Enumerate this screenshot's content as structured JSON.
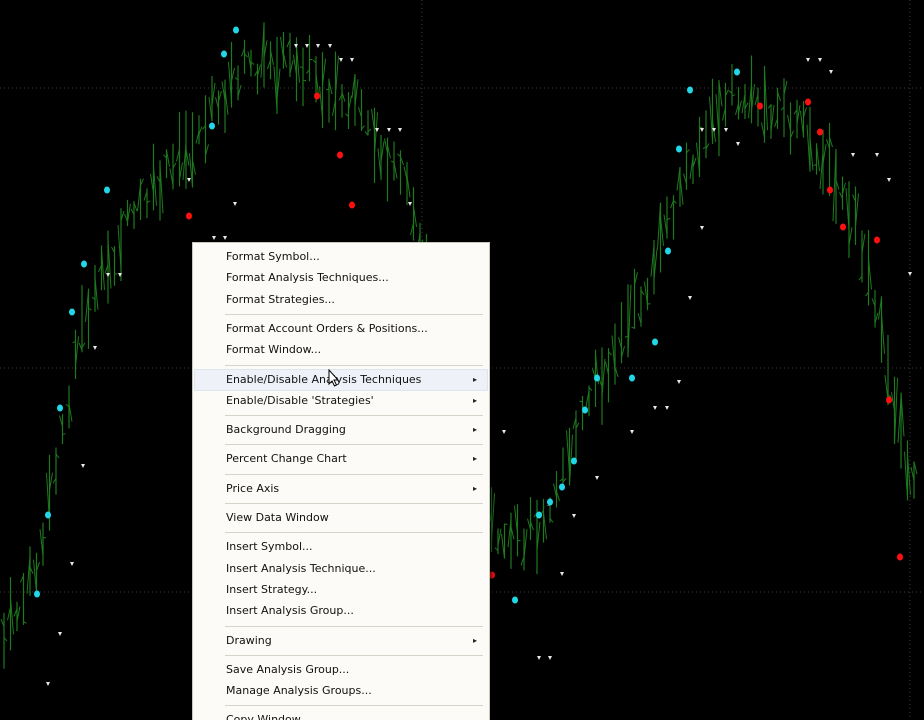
{
  "colors": {
    "background": "#000000",
    "bar": "#1f7a1f",
    "marker_cyan": "#22d8e8",
    "marker_red": "#ff1010",
    "marker_white": "#e8e8e8",
    "menu_bg": "#fcfbf7"
  },
  "context_menu": {
    "items": [
      {
        "label": "Format Symbol...",
        "submenu": false
      },
      {
        "label": "Format Analysis Techniques...",
        "submenu": false
      },
      {
        "label": "Format Strategies...",
        "submenu": false,
        "separator_after": true
      },
      {
        "label": "Format Account Orders & Positions...",
        "submenu": false
      },
      {
        "label": "Format Window...",
        "submenu": false,
        "separator_after": true
      },
      {
        "label": "Enable/Disable Analysis Techniques",
        "submenu": true,
        "highlighted": true
      },
      {
        "label": "Enable/Disable 'Strategies'",
        "submenu": true,
        "separator_after": true
      },
      {
        "label": "Background Dragging",
        "submenu": true,
        "separator_after": true
      },
      {
        "label": "Percent Change Chart",
        "submenu": true,
        "separator_after": true
      },
      {
        "label": "Price Axis",
        "submenu": true,
        "separator_after": true
      },
      {
        "label": "View Data Window",
        "submenu": false,
        "separator_after": true
      },
      {
        "label": "Insert Symbol...",
        "submenu": false
      },
      {
        "label": "Insert Analysis Technique...",
        "submenu": false
      },
      {
        "label": "Insert Strategy...",
        "submenu": false
      },
      {
        "label": "Insert Analysis Group...",
        "submenu": false,
        "separator_after": true
      },
      {
        "label": "Drawing",
        "submenu": true,
        "separator_after": true
      },
      {
        "label": "Save Analysis Group...",
        "submenu": false
      },
      {
        "label": "Manage Analysis Groups...",
        "submenu": false,
        "separator_after": true
      },
      {
        "label": "Copy Window",
        "submenu": false
      }
    ],
    "submenu_arrow": "▸"
  }
}
